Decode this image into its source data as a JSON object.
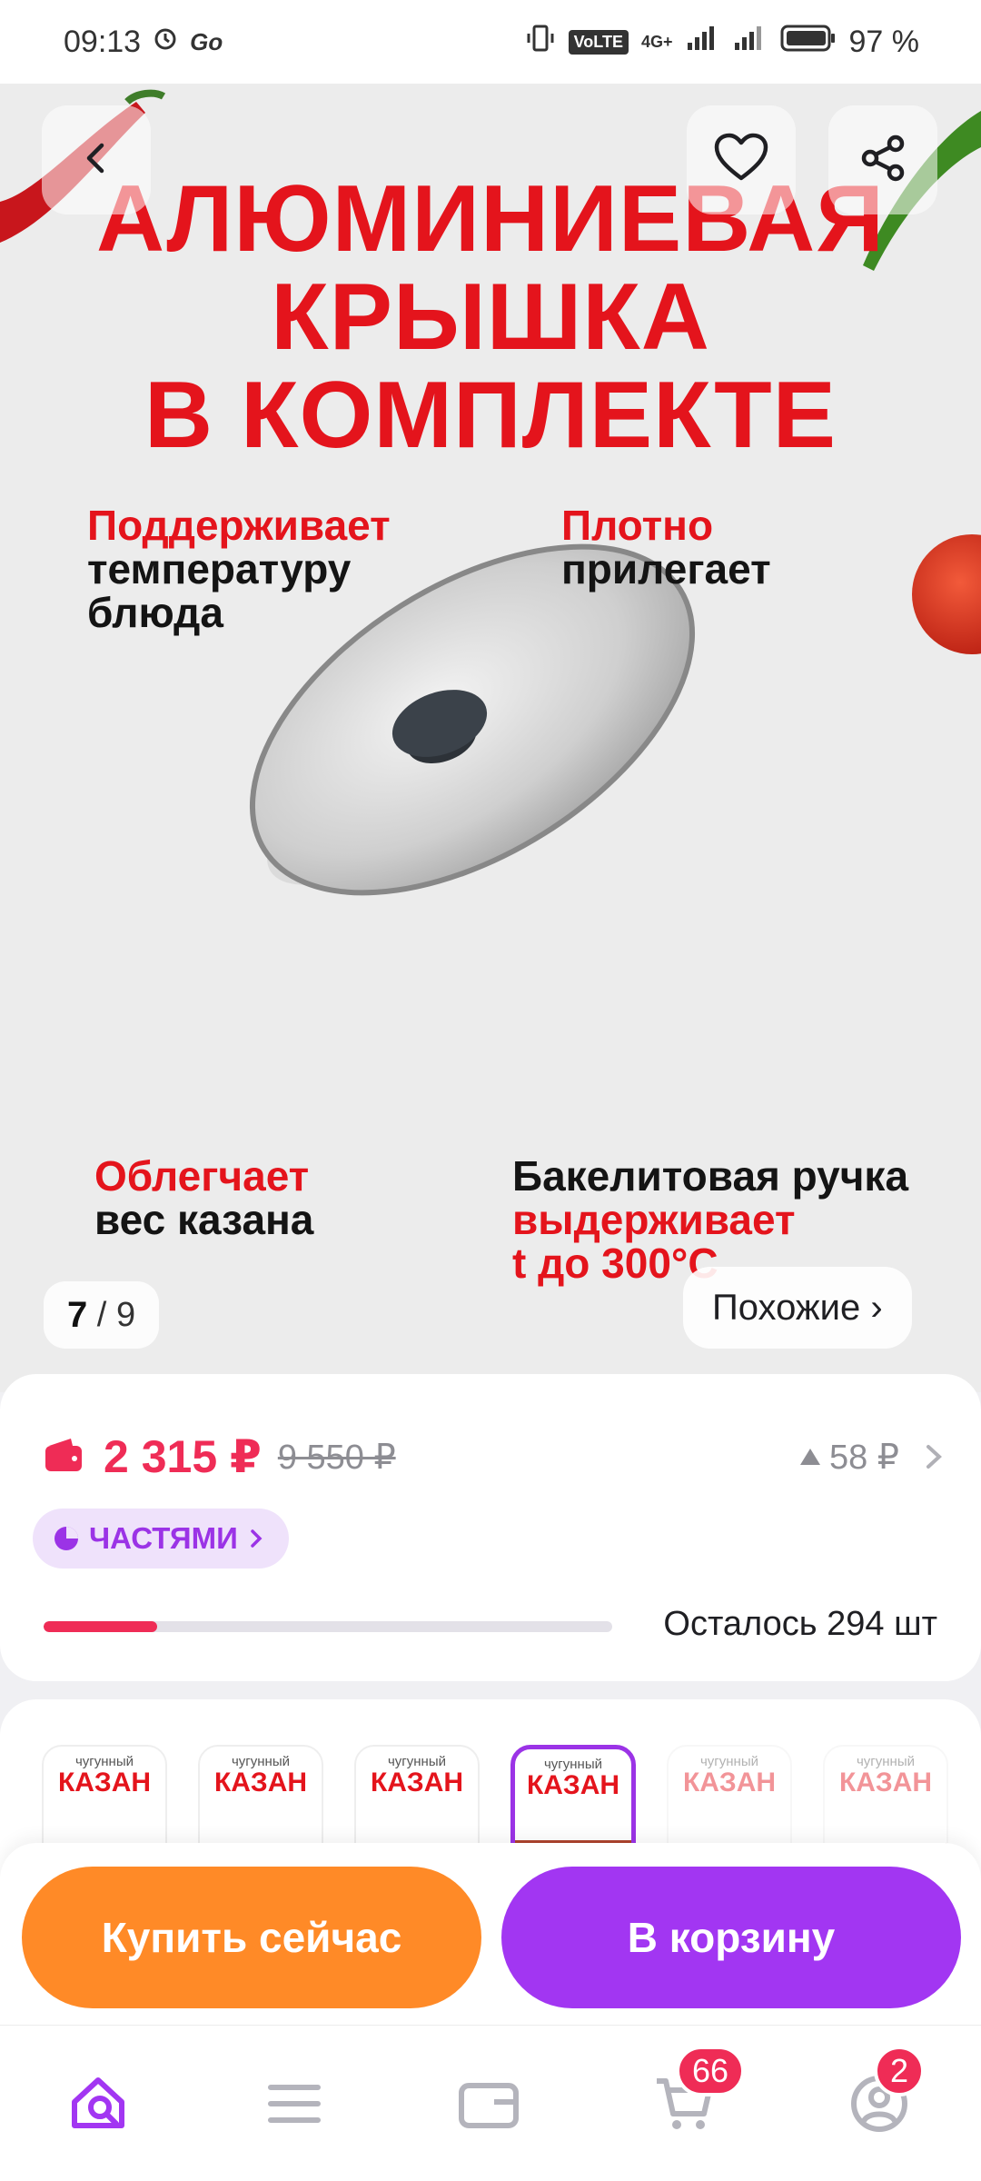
{
  "status_bar": {
    "time": "09:13",
    "network_label": "VoLTE",
    "signal_label": "4G+",
    "battery": "97 %"
  },
  "gallery": {
    "headline": [
      "АЛЮМИНИЕВАЯ",
      "КРЫШКА",
      "В КОМПЛЕКТЕ"
    ],
    "features": [
      {
        "red": "Поддерживает",
        "black": "температуру\nблюда"
      },
      {
        "red": "Плотно",
        "black": "прилегает"
      },
      {
        "red": "Облегчает",
        "black": "вес казана"
      },
      {
        "black": "Бакелитовая ручка",
        "red": "выдерживает\nt до 300°C"
      }
    ],
    "current_index": "7",
    "counter_separator": " / ",
    "total": "9",
    "similar_label": "Похожие ›",
    "icons": [
      "back-icon",
      "heart-icon",
      "share-icon"
    ]
  },
  "price": {
    "current": "2 315 ₽",
    "old": "9 550 ₽",
    "delta": "58 ₽",
    "installments_label": "ЧАСТЯМИ",
    "stock_text": "Осталось 294 шт",
    "stock_fill_fraction": 0.2
  },
  "variants": {
    "top_label": "чугунный",
    "title": "КАЗАН",
    "count": 6,
    "selected_index": 3
  },
  "actions": {
    "buy_now": "Купить сейчас",
    "add_to_cart": "В корзину"
  },
  "bottom_nav": {
    "cart_badge": "66",
    "profile_badge": "2",
    "icons": [
      "home-search-icon",
      "catalog-icon",
      "wallet-icon",
      "cart-icon",
      "profile-icon"
    ]
  },
  "colors": {
    "accent_purple": "#a236f2",
    "accent_orange": "#ff8a27",
    "price_red": "#ef2c56",
    "headline_red": "#e4141c"
  }
}
